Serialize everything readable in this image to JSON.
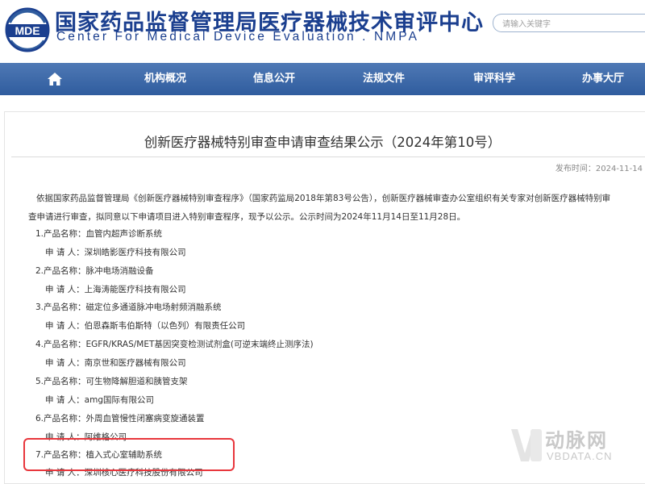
{
  "header": {
    "logo_text": "MDE",
    "title_cn": "国家药品监督管理局医疗器械技术审评中心",
    "title_en": "Center For Medical Device Evaluation . NMPA",
    "search_placeholder": "请输入关键字"
  },
  "nav": {
    "home_icon": "home-icon",
    "items": [
      "机构概况",
      "信息公开",
      "法规文件",
      "审评科学",
      "办事大厅"
    ]
  },
  "article": {
    "title": "创新医疗器械特别审查申请审查结果公示（2024年第10号）",
    "publish_date": "发布时间：2024-11-14",
    "intro_line1": "依据国家药品监督管理局《创新医疗器械特别审查程序》（国家药监局2018年第83号公告），创新医疗器械审查办公室组织有关专家对创新医疗器械特别审",
    "intro_line2": "查申请进行审查，拟同意以下申请项目进入特别审查程序，现予以公示。公示时间为2024年11月14日至11月28日。",
    "items": [
      {
        "product": "1.产品名称：血管内超声诊断系统",
        "applicant": "申 请 人：深圳皓影医疗科技有限公司"
      },
      {
        "product": "2.产品名称：脉冲电场消融设备",
        "applicant": "申 请 人：上海涛能医疗科技有限公司"
      },
      {
        "product": "3.产品名称：磁定位多通道脉冲电场射频消融系统",
        "applicant": "申 请 人：伯恩森斯韦伯斯特（以色列）有限责任公司"
      },
      {
        "product": "4.产品名称：EGFR/KRAS/MET基因突变检测试剂盒(可逆末端终止测序法)",
        "applicant": "申 请 人：南京世和医疗器械有限公司"
      },
      {
        "product": "5.产品名称：可生物降解胆道和胰管支架",
        "applicant": "申 请 人：amg国际有限公司"
      },
      {
        "product": "6.产品名称：外周血管慢性闭塞病变旋通装置",
        "applicant": "申 请 人：阿维格公司"
      },
      {
        "product": "7.产品名称：植入式心室辅助系统",
        "applicant": "申 请 人：深圳核心医疗科技股份有限公司"
      }
    ]
  },
  "watermark": {
    "brand": "动脉网",
    "domain": "VBDATA.CN"
  },
  "colors": {
    "brand_blue": "#1b3f8f",
    "nav_blue": "#3a66a8",
    "highlight_red": "#e8363c"
  }
}
